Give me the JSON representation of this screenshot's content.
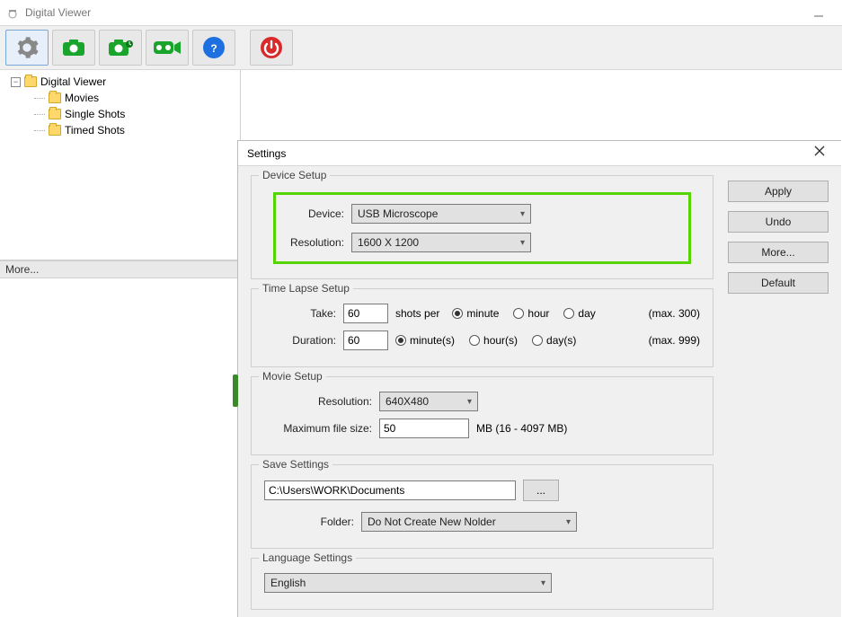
{
  "titlebar": {
    "app_title": "Digital Viewer"
  },
  "toolbar": {
    "icons": [
      "gear-icon",
      "camera-icon",
      "camera-burst-icon",
      "video-tape-icon",
      "help-icon",
      "power-icon"
    ]
  },
  "tree": {
    "root": "Digital Viewer",
    "children": [
      "Movies",
      "Single Shots",
      "Timed Shots"
    ]
  },
  "left_pane": {
    "more_label": "More..."
  },
  "settings": {
    "title": "Settings",
    "buttons": {
      "apply": "Apply",
      "undo": "Undo",
      "more": "More...",
      "default": "Default"
    },
    "device_setup": {
      "legend": "Device Setup",
      "device_label": "Device:",
      "device_value": "USB Microscope",
      "resolution_label": "Resolution:",
      "resolution_value": "1600 X 1200"
    },
    "time_lapse": {
      "legend": "Time Lapse Setup",
      "take_label": "Take:",
      "take_value": "60",
      "shots_per_label": "shots per",
      "take_max": "(max. 300)",
      "duration_label": "Duration:",
      "duration_value": "60",
      "duration_max": "(max. 999)",
      "unit_minute": "minute",
      "unit_hour": "hour",
      "unit_day": "day",
      "unit_minutes": "minute(s)",
      "unit_hours": "hour(s)",
      "unit_days": "day(s)"
    },
    "movie_setup": {
      "legend": "Movie Setup",
      "resolution_label": "Resolution:",
      "resolution_value": "640X480",
      "max_size_label": "Maximum file size:",
      "max_size_value": "50",
      "max_size_hint": "MB (16 - 4097 MB)"
    },
    "save_settings": {
      "legend": "Save Settings",
      "path_value": "C:\\Users\\WORK\\Documents",
      "browse_label": "...",
      "folder_label": "Folder:",
      "folder_value": "Do Not Create New Nolder"
    },
    "language_settings": {
      "legend": "Language Settings",
      "language_value": "English"
    }
  }
}
